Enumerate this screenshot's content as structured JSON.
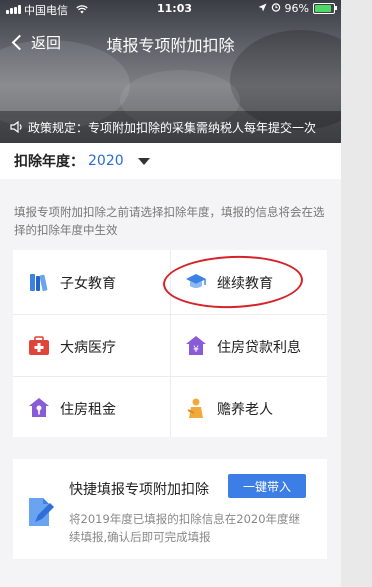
{
  "status_bar": {
    "carrier": "中国电信",
    "time": "11:03",
    "battery": "96%"
  },
  "nav": {
    "back_label": "返回",
    "title": "填报专项附加扣除"
  },
  "notice": {
    "text": "政策规定：专项附加扣除的采集需纳税人每年提交一次"
  },
  "year_selector": {
    "label": "扣除年度：",
    "value": "2020"
  },
  "hint": "填报专项附加扣除之前请选择扣除年度，填报的信息将会在选择的扣除年度中生效",
  "items": [
    {
      "label": "子女教育",
      "icon": "books-icon"
    },
    {
      "label": "继续教育",
      "icon": "graduation-cap-icon"
    },
    {
      "label": "大病医疗",
      "icon": "medical-kit-icon"
    },
    {
      "label": "住房贷款利息",
      "icon": "house-loan-icon"
    },
    {
      "label": "住房租金",
      "icon": "house-key-icon"
    },
    {
      "label": "赡养老人",
      "icon": "elderly-care-icon"
    }
  ],
  "quick_fill": {
    "title": "快捷填报专项附加扣除",
    "button_label": "一键带入",
    "description": "将2019年度已填报的扣除信息在2020年度继续填报,确认后即可完成填报"
  },
  "colors": {
    "accent": "#3c7ee6",
    "year_value": "#2d6bd6",
    "annotation_circle": "#d6222a"
  }
}
